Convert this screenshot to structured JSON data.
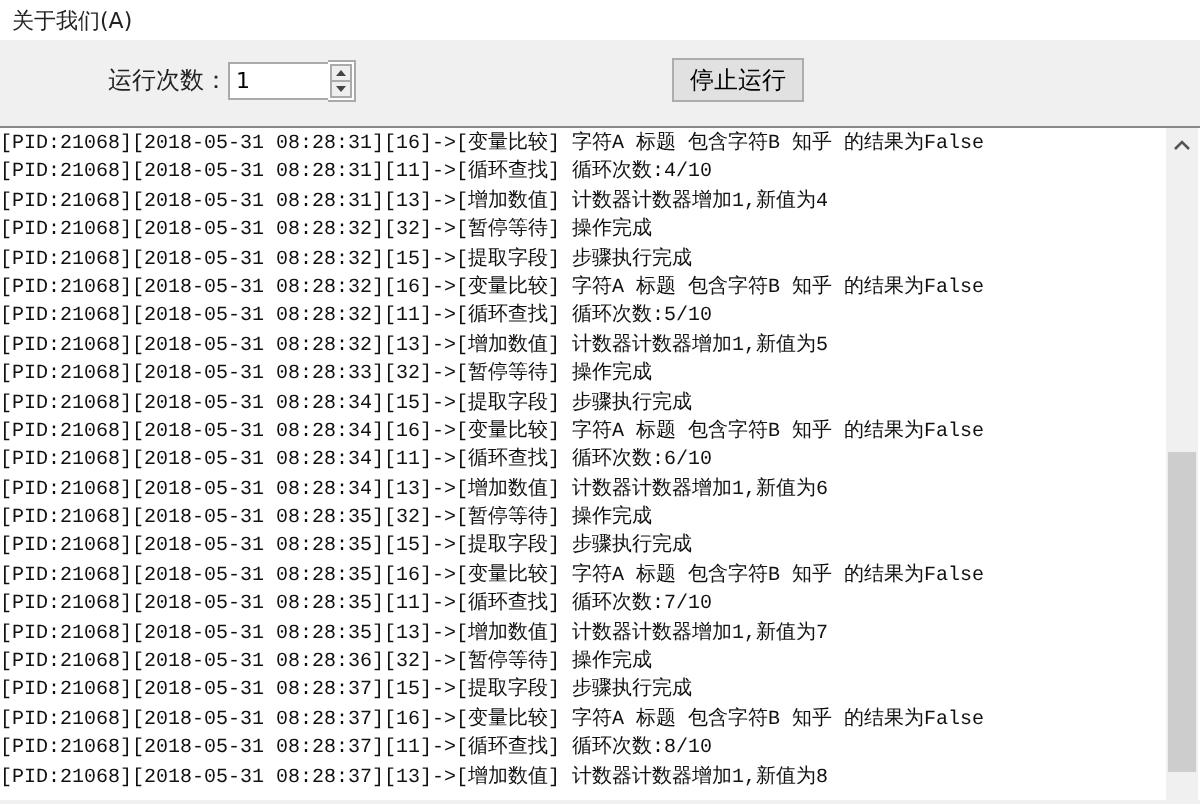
{
  "menu_bar": {
    "items": [
      "关于我们(A)"
    ]
  },
  "controls": {
    "run_count_label": "运行次数：",
    "run_count_value": "1",
    "stop_button": "停止运行"
  },
  "log_lines": [
    "[PID:21068][2018-05-31 08:28:31][16]->[变量比较] 字符A 标题 包含字符B 知乎 的结果为False",
    "[PID:21068][2018-05-31 08:28:31][11]->[循环查找] 循环次数:4/10",
    "[PID:21068][2018-05-31 08:28:31][13]->[增加数值] 计数器计数器增加1,新值为4",
    "[PID:21068][2018-05-31 08:28:32][32]->[暂停等待] 操作完成",
    "[PID:21068][2018-05-31 08:28:32][15]->[提取字段] 步骤执行完成",
    "[PID:21068][2018-05-31 08:28:32][16]->[变量比较] 字符A 标题 包含字符B 知乎 的结果为False",
    "[PID:21068][2018-05-31 08:28:32][11]->[循环查找] 循环次数:5/10",
    "[PID:21068][2018-05-31 08:28:32][13]->[增加数值] 计数器计数器增加1,新值为5",
    "[PID:21068][2018-05-31 08:28:33][32]->[暂停等待] 操作完成",
    "[PID:21068][2018-05-31 08:28:34][15]->[提取字段] 步骤执行完成",
    "[PID:21068][2018-05-31 08:28:34][16]->[变量比较] 字符A 标题 包含字符B 知乎 的结果为False",
    "[PID:21068][2018-05-31 08:28:34][11]->[循环查找] 循环次数:6/10",
    "[PID:21068][2018-05-31 08:28:34][13]->[增加数值] 计数器计数器增加1,新值为6",
    "[PID:21068][2018-05-31 08:28:35][32]->[暂停等待] 操作完成",
    "[PID:21068][2018-05-31 08:28:35][15]->[提取字段] 步骤执行完成",
    "[PID:21068][2018-05-31 08:28:35][16]->[变量比较] 字符A 标题 包含字符B 知乎 的结果为False",
    "[PID:21068][2018-05-31 08:28:35][11]->[循环查找] 循环次数:7/10",
    "[PID:21068][2018-05-31 08:28:35][13]->[增加数值] 计数器计数器增加1,新值为7",
    "[PID:21068][2018-05-31 08:28:36][32]->[暂停等待] 操作完成",
    "[PID:21068][2018-05-31 08:28:37][15]->[提取字段] 步骤执行完成",
    "[PID:21068][2018-05-31 08:28:37][16]->[变量比较] 字符A 标题 包含字符B 知乎 的结果为False",
    "[PID:21068][2018-05-31 08:28:37][11]->[循环查找] 循环次数:8/10",
    "[PID:21068][2018-05-31 08:28:37][13]->[增加数值] 计数器计数器增加1,新值为8"
  ]
}
